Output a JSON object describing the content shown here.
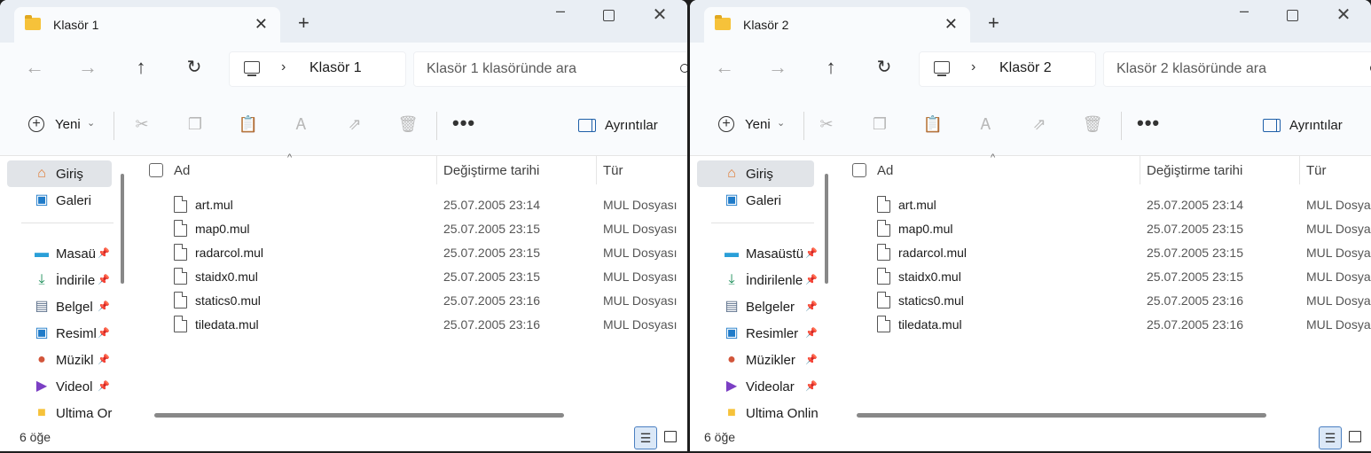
{
  "windows": [
    {
      "tab_title": "Klasör 1",
      "address": "Klasör 1",
      "search_placeholder": "Klasör 1 klasöründe ara",
      "toolbar": {
        "new_label": "Yeni",
        "details_label": "Ayrıntılar"
      },
      "sidebar": {
        "items": [
          {
            "label": "Giriş",
            "icon": "home-icon"
          },
          {
            "label": "Galeri",
            "icon": "gallery-icon"
          },
          {
            "label": "Masaü",
            "icon": "desktop-icon"
          },
          {
            "label": "İndirile",
            "icon": "download-icon"
          },
          {
            "label": "Belgel",
            "icon": "documents-icon"
          },
          {
            "label": "Resiml",
            "icon": "pictures-icon"
          },
          {
            "label": "Müzikl",
            "icon": "music-icon"
          },
          {
            "label": "Videol",
            "icon": "videos-icon"
          },
          {
            "label": "Ultima Or",
            "icon": "folder-icon"
          }
        ]
      },
      "columns": {
        "name": "Ad",
        "date": "Değiştirme tarihi",
        "type": "Tür"
      },
      "files": [
        {
          "name": "art.mul",
          "date": "25.07.2005 23:14",
          "type": "MUL Dosyası"
        },
        {
          "name": "map0.mul",
          "date": "25.07.2005 23:15",
          "type": "MUL Dosyası"
        },
        {
          "name": "radarcol.mul",
          "date": "25.07.2005 23:15",
          "type": "MUL Dosyası"
        },
        {
          "name": "staidx0.mul",
          "date": "25.07.2005 23:15",
          "type": "MUL Dosyası"
        },
        {
          "name": "statics0.mul",
          "date": "25.07.2005 23:16",
          "type": "MUL Dosyası"
        },
        {
          "name": "tiledata.mul",
          "date": "25.07.2005 23:16",
          "type": "MUL Dosyası"
        }
      ],
      "status": "6 öğe"
    },
    {
      "tab_title": "Klasör 2",
      "address": "Klasör 2",
      "search_placeholder": "Klasör 2 klasöründe ara",
      "toolbar": {
        "new_label": "Yeni",
        "details_label": "Ayrıntılar"
      },
      "sidebar": {
        "items": [
          {
            "label": "Giriş",
            "icon": "home-icon"
          },
          {
            "label": "Galeri",
            "icon": "gallery-icon"
          },
          {
            "label": "Masaüstü",
            "icon": "desktop-icon"
          },
          {
            "label": "İndirilenle",
            "icon": "download-icon"
          },
          {
            "label": "Belgeler",
            "icon": "documents-icon"
          },
          {
            "label": "Resimler",
            "icon": "pictures-icon"
          },
          {
            "label": "Müzikler",
            "icon": "music-icon"
          },
          {
            "label": "Videolar",
            "icon": "videos-icon"
          },
          {
            "label": "Ultima Onlin",
            "icon": "folder-icon"
          }
        ]
      },
      "columns": {
        "name": "Ad",
        "date": "Değiştirme tarihi",
        "type": "Tür"
      },
      "files": [
        {
          "name": "art.mul",
          "date": "25.07.2005 23:14",
          "type": "MUL Dosya"
        },
        {
          "name": "map0.mul",
          "date": "25.07.2005 23:15",
          "type": "MUL Dosya"
        },
        {
          "name": "radarcol.mul",
          "date": "25.07.2005 23:15",
          "type": "MUL Dosya"
        },
        {
          "name": "staidx0.mul",
          "date": "25.07.2005 23:15",
          "type": "MUL Dosya"
        },
        {
          "name": "statics0.mul",
          "date": "25.07.2005 23:16",
          "type": "MUL Dosya"
        },
        {
          "name": "tiledata.mul",
          "date": "25.07.2005 23:16",
          "type": "MUL Dosya"
        }
      ],
      "status": "6 öğe"
    }
  ]
}
